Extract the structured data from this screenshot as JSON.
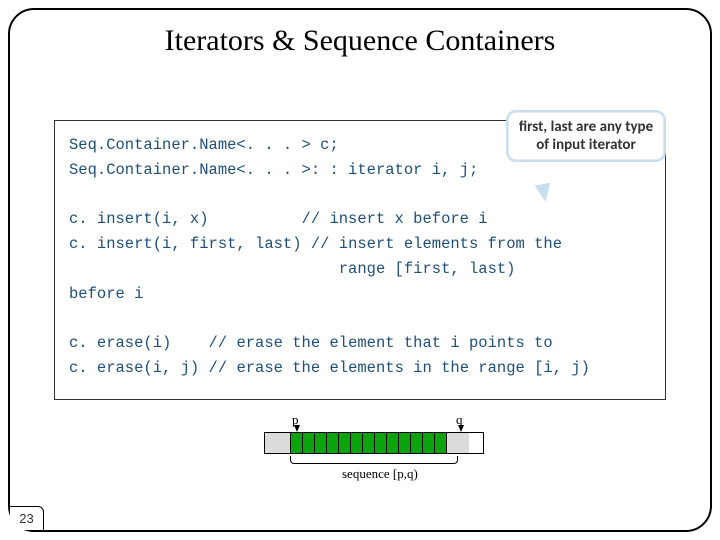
{
  "title": "Iterators & Sequence Containers",
  "callout": "first, last are any type of input iterator",
  "code": {
    "l1": "Seq.Container.Name<. . . > c;",
    "l2": "Seq.Container.Name<. . . >: : iterator i, j;",
    "l3a": "c. insert(i, x)",
    "l3c": "// insert x before i",
    "l4a": "c. insert(i, first, last)",
    "l4c": "// insert elements from the",
    "l5c": "range [first, last)",
    "l6": "before i",
    "l7a": "c. erase(i)",
    "l7c": "// erase the element that i points to",
    "l8a": "c. erase(i, j)",
    "l8c": "// erase the elements in the range [i, j)"
  },
  "diagram": {
    "p": "p",
    "q": "q",
    "seq": "sequence [p,q)"
  },
  "page": "23"
}
